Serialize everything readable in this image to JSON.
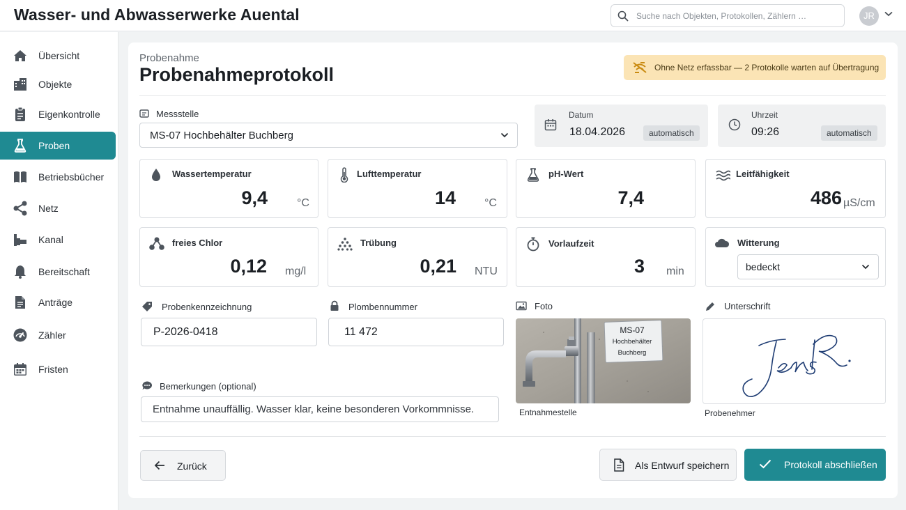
{
  "header": {
    "title": "Wasser- und Abwasserwerke Auental",
    "search_placeholder": "Suche nach Objekten, Protokollen, Zählern …",
    "user_initials": "JR"
  },
  "sidebar": {
    "items": [
      {
        "label": "Übersicht",
        "icon": "home-icon"
      },
      {
        "label": "Objekte",
        "icon": "buildings-icon"
      },
      {
        "label": "Eigenkontrolle",
        "icon": "clipboard-icon"
      },
      {
        "label": "Proben",
        "icon": "flask-icon",
        "active": true
      },
      {
        "label": "Betriebsbücher",
        "icon": "book-icon"
      },
      {
        "label": "Netz",
        "icon": "network-icon"
      },
      {
        "label": "Kanal",
        "icon": "pipe-icon"
      },
      {
        "label": "Bereitschaft",
        "icon": "bell-icon"
      },
      {
        "label": "Anträge",
        "icon": "document-icon"
      },
      {
        "label": "Zähler",
        "icon": "gauge-icon"
      },
      {
        "label": "Fristen",
        "icon": "calendar-icon"
      }
    ]
  },
  "page": {
    "breadcrumb": "Probenahme",
    "title": "Probenahmeprotokoll",
    "offline_notice": "Ohne Netz erfassbar — 2 Protokolle warten auf Übertragung"
  },
  "form": {
    "messstelle": {
      "label": "Messstelle",
      "value": "MS-07 Hochbehälter Buchberg"
    },
    "datum": {
      "label": "Datum",
      "value": "18.04.2026",
      "badge": "automatisch"
    },
    "uhrzeit": {
      "label": "Uhrzeit",
      "value": "09:26",
      "badge": "automatisch"
    },
    "measurements": [
      {
        "label": "Wassertemperatur",
        "value": "9,4",
        "unit": "°C",
        "icon": "water-drop-icon"
      },
      {
        "label": "Lufttemperatur",
        "value": "14",
        "unit": "°C",
        "icon": "thermometer-icon"
      },
      {
        "label": "pH-Wert",
        "value": "7,4",
        "unit": "",
        "icon": "flask-icon"
      },
      {
        "label": "Leitfähigkeit",
        "value": "486",
        "unit": "µS/cm",
        "icon": "waves-icon"
      },
      {
        "label": "freies Chlor",
        "value": "0,12",
        "unit": "mg/l",
        "icon": "molecule-icon"
      },
      {
        "label": "Trübung",
        "value": "0,21",
        "unit": "NTU",
        "icon": "particles-icon"
      },
      {
        "label": "Vorlaufzeit",
        "value": "3",
        "unit": "min",
        "icon": "stopwatch-icon"
      }
    ],
    "witterung": {
      "label": "Witterung",
      "value": "bedeckt"
    },
    "probenkennzeichnung": {
      "label": "Probenkennzeichnung",
      "value": "P-2026-0418"
    },
    "plombennummer": {
      "label": "Plombennummer",
      "value": "11 472"
    },
    "foto": {
      "label": "Foto",
      "caption": "Entnahmestelle",
      "sign_text": [
        "MS-07",
        "Hochbehälter",
        "Buchberg"
      ]
    },
    "unterschrift": {
      "label": "Unterschrift",
      "caption": "Probenehmer"
    },
    "bemerkungen": {
      "label": "Bemerkungen (optional)",
      "value": "Entnahme unauffällig. Wasser klar, keine besonderen Vorkommnisse."
    }
  },
  "actions": {
    "back": "Zurück",
    "draft": "Als Entwurf speichern",
    "submit": "Protokoll abschließen"
  },
  "colors": {
    "accent": "#1f8a92",
    "offline_bg": "#fbe4b5",
    "offline_icon": "#c98a10"
  }
}
